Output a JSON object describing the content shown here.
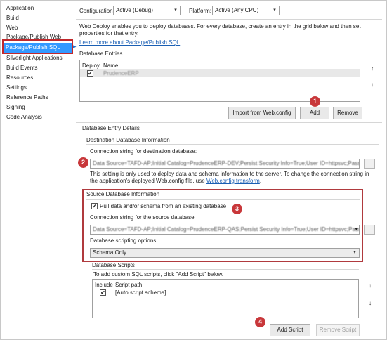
{
  "nav": {
    "items": [
      "Application",
      "Build",
      "Web",
      "Package/Publish Web",
      "Package/Publish SQL",
      "Silverlight Applications",
      "Build Events",
      "Resources",
      "Settings",
      "Reference Paths",
      "Signing",
      "Code Analysis"
    ],
    "selected_index": 4
  },
  "config": {
    "configuration_label": "Configuration:",
    "configuration_value": "Active (Debug)",
    "platform_label": "Platform:",
    "platform_value": "Active (Any CPU)"
  },
  "intro": {
    "description": "Web Deploy enables you to deploy databases. For every database, create an entry in the grid below and then set properties for that entry.",
    "learn_more": "Learn more about Package/Publish SQL"
  },
  "entries": {
    "title": "Database Entries",
    "columns": [
      "Deploy",
      "Name"
    ],
    "rows": [
      {
        "deploy": true,
        "name": "PrudenceERP"
      }
    ],
    "import_button": "Import from Web.config",
    "add_button": "Add",
    "remove_button": "Remove"
  },
  "details": {
    "title": "Database Entry Details",
    "dest_title": "Destination Database Information",
    "dest_conn_label": "Connection string for destination database:",
    "dest_conn_value": "Data Source=TAFD-AP;Initial Catalog=PrudenceERP-DEV;Persist Security Info=True;User ID=httpsvc;Password=httpsvc",
    "dest_note_1": "This setting is only used to deploy data and schema information to the server. To change the connection string in",
    "dest_note_2": "the application's deployed Web.config file, use",
    "dest_note_link": "Web.config transform",
    "dest_note_end": ".",
    "browse_label": "...",
    "source_title": "Source Database Information",
    "pull_label": "Pull data and/or schema from an existing database",
    "pull_checked": true,
    "source_conn_label": "Connection string for the source database:",
    "source_conn_value": "Data Source=TAFD-AP;Initial Catalog=PrudenceERP-QAS;Persist Security Info=True;User ID=httpsvc;Password=httpsvc",
    "scripting_label": "Database scripting options:",
    "scripting_value": "Schema Only"
  },
  "scripts": {
    "title": "Database Scripts",
    "hint": "To add custom SQL scripts, click \"Add Script\" below.",
    "columns": [
      "Include",
      "Script path"
    ],
    "rows": [
      {
        "include": true,
        "path": "[Auto script schema]"
      }
    ],
    "add_button": "Add Script",
    "remove_button": "Remove Script"
  },
  "badges": [
    "1",
    "2",
    "3",
    "4"
  ],
  "colors": {
    "selection": "#3399ff",
    "annotation": "#c8373a",
    "link": "#1a5fb4"
  },
  "icons": {
    "check": "✔",
    "dropdown": "▾",
    "up": "↑",
    "down": "↓",
    "nav_arrow": "▸"
  }
}
